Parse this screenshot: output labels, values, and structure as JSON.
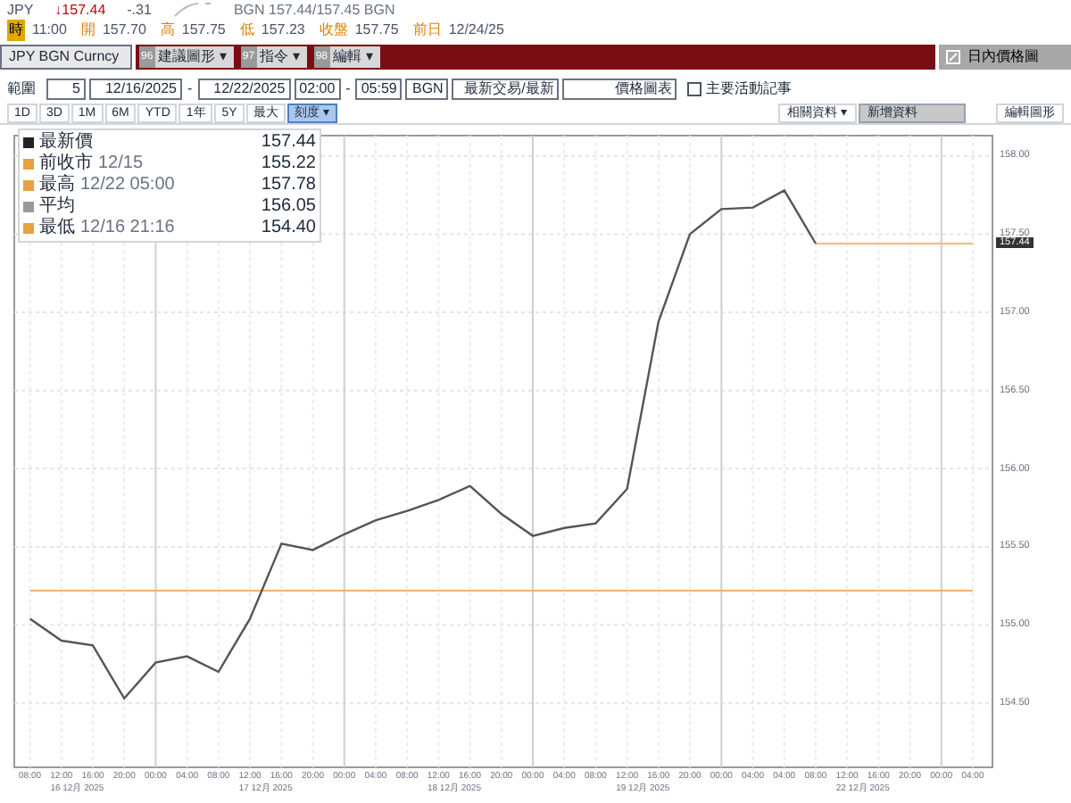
{
  "quote": {
    "ticker": "JPY",
    "last": "↓157.44",
    "change": "-.31",
    "bid_ask": "BGN 157.44/157.45 BGN"
  },
  "stats": [
    {
      "label": "時",
      "value": "11:00"
    },
    {
      "label": "開",
      "value": "157.70"
    },
    {
      "label": "高",
      "value": "157.75"
    },
    {
      "label": "低",
      "value": "157.23"
    },
    {
      "label": "收盤",
      "value": "157.75"
    },
    {
      "label": "前日",
      "value": "12/24/25"
    }
  ],
  "toolbar": {
    "security": "JPY BGN Curncy",
    "menus": [
      {
        "badge": "96",
        "label": "建議圖形 ▾"
      },
      {
        "badge": "97",
        "label": "指令 ▾"
      },
      {
        "badge": "98",
        "label": "編輯 ▾"
      }
    ],
    "title_button": "日內價格圖"
  },
  "range": {
    "label": "範圍",
    "days": "5",
    "start_date": "12/16/2025",
    "date_separator": "-",
    "end_date": "12/22/2025",
    "start_time": "02:00",
    "time_separator": "-",
    "end_time": "05:59",
    "source": "BGN",
    "field": "最新交易/最新",
    "chart_type": "價格圖表",
    "events": {
      "label": "主要活動記事",
      "checked": false
    }
  },
  "periods": [
    {
      "label": "1D",
      "selected": false
    },
    {
      "label": "3D",
      "selected": false
    },
    {
      "label": "1M",
      "selected": false
    },
    {
      "label": "6M",
      "selected": false
    },
    {
      "label": "YTD",
      "selected": false
    },
    {
      "label": "1年",
      "selected": false
    },
    {
      "label": "5Y",
      "selected": false
    },
    {
      "label": "最大",
      "selected": false
    },
    {
      "label": "刻度 ▾",
      "selected": true
    }
  ],
  "right_tools": {
    "related": "相關資料 ▾",
    "add_data": "新增資料",
    "edit_chart": "編輯圖形"
  },
  "legend": [
    {
      "label": "最新價",
      "value": "157.44",
      "color": "#222222"
    },
    {
      "label": "前收市",
      "date": "12/15",
      "value": "155.22",
      "color": "#e8a040"
    },
    {
      "label": "最高",
      "date": "12/22 05:00",
      "value": "157.78",
      "color": "#e8a040"
    },
    {
      "label": "平均",
      "value": "156.05",
      "color": "#999999"
    },
    {
      "label": "最低",
      "date": "12/16 21:16",
      "value": "154.40",
      "color": "#e8a040"
    }
  ],
  "price_tag": "157.44",
  "chart": {
    "date_labels": [
      "16 12月 2025",
      "17 12月 2025",
      "18 12月 2025",
      "19 12月 2025",
      "22 12月 2025"
    ],
    "chart_data": {
      "type": "line",
      "ylim": [
        154.09,
        158.13
      ],
      "yticks": [
        {
          "value": 154.5,
          "label": "154.50"
        },
        {
          "value": 155,
          "label": "155.00"
        },
        {
          "value": 155.5,
          "label": "155.50"
        },
        {
          "value": 156,
          "label": "156.00"
        },
        {
          "value": 156.5,
          "label": "156.50"
        },
        {
          "value": 157,
          "label": "157.00"
        },
        {
          "value": 157.5,
          "label": "157.50"
        },
        {
          "value": 158,
          "label": "158.00"
        }
      ],
      "categories": [
        "08:00",
        "12:00",
        "16:00",
        "20:00",
        "00:00",
        "04:00",
        "08:00",
        "12:00",
        "16:00",
        "20:00",
        "00:00",
        "04:00",
        "08:00",
        "12:00",
        "16:00",
        "20:00",
        "00:00",
        "04:00",
        "08:00",
        "12:00",
        "16:00",
        "20:00",
        "00:00",
        "04:00",
        "04:00",
        "08:00",
        "12:00",
        "16:00",
        "20:00",
        "00:00",
        "04:00"
      ],
      "series": [
        {
          "color": "#f0b070",
          "values": [
            155.22,
            155.22,
            155.22,
            155.22,
            155.22,
            155.22,
            155.22,
            155.22,
            155.22,
            155.22,
            155.22,
            155.22,
            155.22,
            155.22,
            155.22,
            155.22,
            155.22,
            155.22,
            155.22,
            155.22,
            155.22,
            155.22,
            155.22,
            155.22,
            155.22,
            155.22,
            155.22,
            155.22,
            155.22,
            155.22,
            155.22
          ]
        },
        {
          "color": "#f0c060",
          "values": [
            null,
            null,
            null,
            null,
            null,
            null,
            null,
            null,
            null,
            null,
            null,
            null,
            null,
            null,
            null,
            null,
            null,
            null,
            null,
            null,
            null,
            null,
            null,
            null,
            null,
            157.44,
            157.44,
            157.44,
            157.44,
            157.44,
            157.44
          ]
        },
        {
          "color": "#555555",
          "values": [
            155.04,
            154.9,
            154.87,
            154.53,
            154.76,
            154.8,
            154.7,
            155.04,
            155.52,
            155.48,
            155.58,
            155.67,
            155.73,
            155.8,
            155.89,
            155.71,
            155.57,
            155.62,
            155.65,
            155.87,
            156.94,
            157.5,
            157.66,
            157.67,
            157.78,
            157.44,
            null,
            null,
            null,
            null,
            null
          ]
        }
      ],
      "grid": true
    }
  }
}
